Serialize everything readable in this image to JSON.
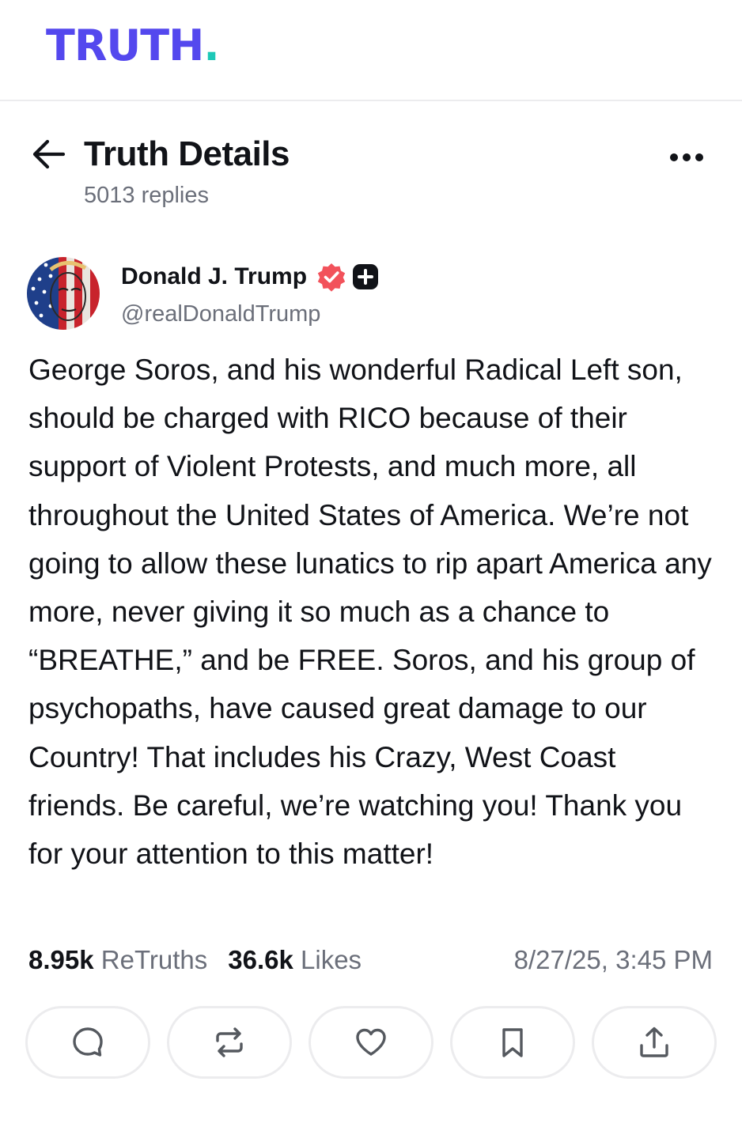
{
  "brand": {
    "logo_text": "TRUTH",
    "logo_dot": ".",
    "primary_color": "#5448ee",
    "accent_color": "#1ec8b7"
  },
  "header": {
    "title": "Truth Details",
    "replies": "5013 replies",
    "back_icon": "arrow-left-icon",
    "more_icon": "more-horizontal-icon"
  },
  "post": {
    "author_name": "Donald J. Trump",
    "handle": "@realDonaldTrump",
    "verified_icon": "verified-badge-icon",
    "verified_color": "#f2525b",
    "plus_badge_icon": "plus-badge-icon",
    "body": "George Soros, and his wonderful Radical Left son, should be charged with RICO because of their support of Violent Protests, and much more, all throughout the United States of America. We’re not going to allow these lunatics to rip apart America any more, never giving it so much as a chance to “BREATHE,” and be FREE. Soros, and his group of psychopaths, have caused great damage to our Country! That includes his Crazy, West Coast friends. Be careful, we’re watching you! Thank you for your attention to this matter!",
    "retruths_count": "8.95k",
    "retruths_label": "ReTruths",
    "likes_count": "36.6k",
    "likes_label": "Likes",
    "timestamp": "8/27/25, 3:45 PM"
  },
  "actions": [
    {
      "name": "reply",
      "icon": "comment-icon"
    },
    {
      "name": "retruth",
      "icon": "repost-icon"
    },
    {
      "name": "like",
      "icon": "heart-icon"
    },
    {
      "name": "bookmark",
      "icon": "bookmark-icon"
    },
    {
      "name": "share",
      "icon": "share-icon"
    }
  ]
}
